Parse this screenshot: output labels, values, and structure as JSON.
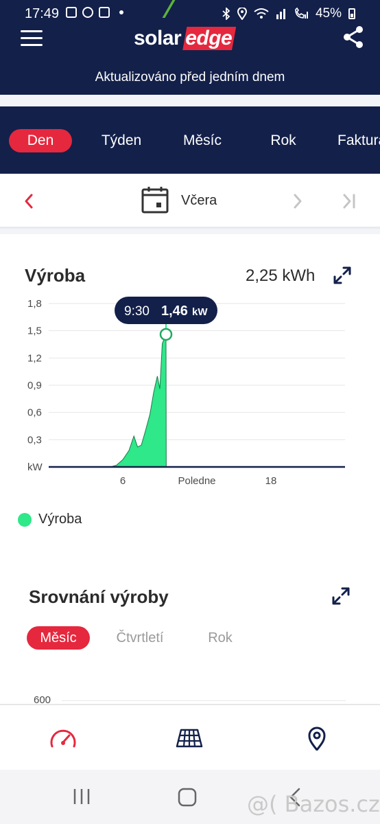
{
  "status_bar": {
    "time": "17:49",
    "battery": "45%",
    "icons_left": [
      "image-icon",
      "shield-icon",
      "mail-icon",
      "dot-icon"
    ],
    "icons_right": [
      "bluetooth-icon",
      "location-icon",
      "wifi-icon",
      "signal-icon",
      "call-icon",
      "signal-icon",
      "battery-icon"
    ]
  },
  "header": {
    "logo_part1": "solar",
    "logo_part2": "edge",
    "updated_text": "Aktualizováno před jedním dnem"
  },
  "tabs": [
    {
      "label": "Den",
      "active": true
    },
    {
      "label": "Týden",
      "active": false
    },
    {
      "label": "Měsíc",
      "active": false
    },
    {
      "label": "Rok",
      "active": false
    },
    {
      "label": "Faktura",
      "active": false
    }
  ],
  "date_selector": {
    "label": "Včera"
  },
  "production": {
    "title": "Výroba",
    "total": "2,25 kWh",
    "tooltip_time": "9:30",
    "tooltip_value": "1,46",
    "tooltip_unit": "kW",
    "legend_label": "Výroba"
  },
  "chart_data": {
    "type": "area",
    "title": "Výroba",
    "xlabel": "",
    "ylabel": "kW",
    "y_ticks": [
      "1,8",
      "1,5",
      "1,2",
      "0,9",
      "0,6",
      "0,3",
      "kW"
    ],
    "x_ticks": [
      {
        "hour": 6,
        "label": "6"
      },
      {
        "hour": 12,
        "label": "Poledne"
      },
      {
        "hour": 18,
        "label": "18"
      }
    ],
    "xlim": [
      0,
      24
    ],
    "ylim": [
      0,
      1.8
    ],
    "grid": true,
    "color": "#2ee889",
    "series": [
      {
        "name": "Výroba",
        "x": [
          5.0,
          5.5,
          6.0,
          6.5,
          6.9,
          7.2,
          7.5,
          7.8,
          8.2,
          8.5,
          8.8,
          9.0,
          9.2,
          9.5,
          9.52
        ],
        "y": [
          0.0,
          0.02,
          0.08,
          0.18,
          0.34,
          0.22,
          0.24,
          0.38,
          0.58,
          0.82,
          1.0,
          0.86,
          1.36,
          1.46,
          0.0
        ]
      }
    ],
    "highlight": {
      "x": 9.5,
      "y": 1.46
    }
  },
  "comparison": {
    "title": "Srovnání výroby",
    "tabs": [
      {
        "label": "Měsíc",
        "active": true
      },
      {
        "label": "Čtvrtletí",
        "active": false
      },
      {
        "label": "Rok",
        "active": false
      }
    ],
    "y_tick_top": "600"
  },
  "bottom_nav": [
    "dashboard-icon",
    "solar-panel-icon",
    "location-pin-icon"
  ],
  "watermark": "@( Bazos.cz",
  "colors": {
    "navy": "#13204a",
    "accent_red": "#e5283e",
    "production_green": "#2ee889"
  }
}
